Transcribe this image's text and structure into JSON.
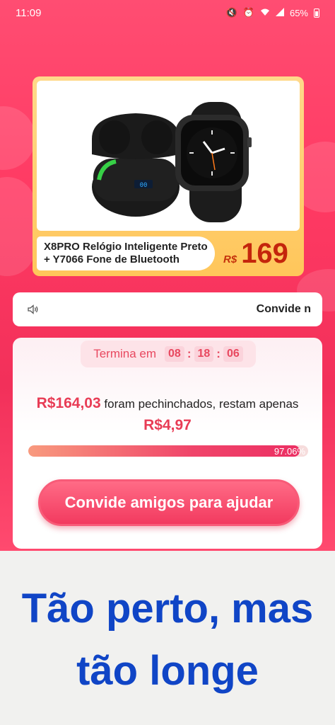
{
  "status_bar": {
    "time": "11:09",
    "battery_text": "65%",
    "icons": [
      "mute-icon",
      "alarm-icon",
      "wifi-icon",
      "signal-icon",
      "battery-icon"
    ]
  },
  "product": {
    "name": "X8PRO Relógio Inteligente Preto + Y7066 Fone de Bluetooth",
    "currency": "R$",
    "price": "169",
    "earbuds_display": "00"
  },
  "invite_bar": {
    "text": "Convide n"
  },
  "bargain": {
    "timer_label": "Termina em",
    "hours": "08",
    "minutes": "18",
    "seconds": "06",
    "bargained_amount": "R$164,03",
    "text_middle": "foram pechinchados, restam apenas",
    "remaining_amount": "R$4,97",
    "progress_percent": 97.06,
    "progress_label": "97.06%",
    "cta_label": "Convide amigos para ajudar"
  },
  "caption": {
    "text": "Tão perto, mas tão longe"
  },
  "colors": {
    "background_red": "#ff3a63",
    "accent_pink": "#e83c55",
    "caption_blue": "#1045c6",
    "price_orange": "#c4250c"
  }
}
